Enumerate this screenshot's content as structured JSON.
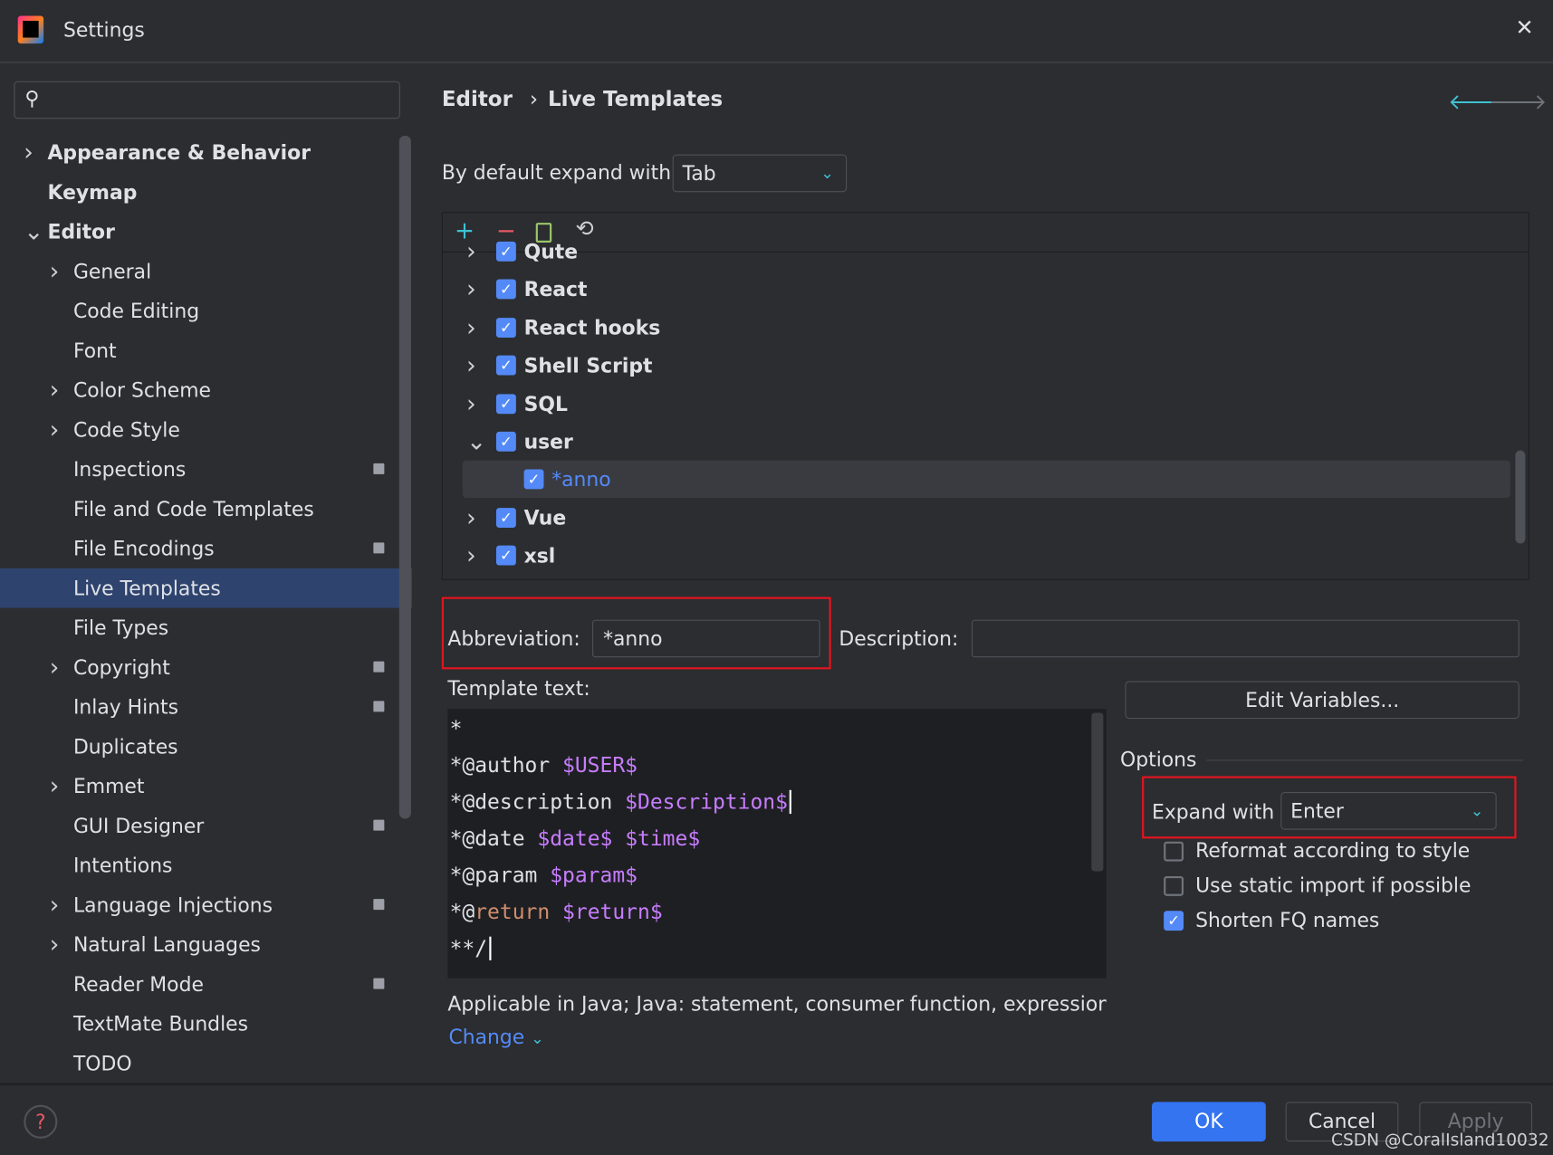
{
  "window": {
    "title": "Settings",
    "close": "✕"
  },
  "search": {
    "placeholder": "",
    "icon": "search-icon"
  },
  "sidebar": {
    "items": [
      {
        "label": "Appearance & Behavior",
        "level": 0,
        "chevron": "right",
        "bold": true
      },
      {
        "label": "Keymap",
        "level": 0,
        "bold": true
      },
      {
        "label": "Editor",
        "level": 0,
        "chevron": "down",
        "bold": true
      },
      {
        "label": "General",
        "level": 1,
        "chevron": "right"
      },
      {
        "label": "Code Editing",
        "level": 1
      },
      {
        "label": "Font",
        "level": 1
      },
      {
        "label": "Color Scheme",
        "level": 1,
        "chevron": "right"
      },
      {
        "label": "Code Style",
        "level": 1,
        "chevron": "right"
      },
      {
        "label": "Inspections",
        "level": 1,
        "pin": true
      },
      {
        "label": "File and Code Templates",
        "level": 1
      },
      {
        "label": "File Encodings",
        "level": 1,
        "pin": true
      },
      {
        "label": "Live Templates",
        "level": 1,
        "selected": true
      },
      {
        "label": "File Types",
        "level": 1
      },
      {
        "label": "Copyright",
        "level": 1,
        "chevron": "right",
        "pin": true
      },
      {
        "label": "Inlay Hints",
        "level": 1,
        "pin": true
      },
      {
        "label": "Duplicates",
        "level": 1
      },
      {
        "label": "Emmet",
        "level": 1,
        "chevron": "right"
      },
      {
        "label": "GUI Designer",
        "level": 1,
        "pin": true
      },
      {
        "label": "Intentions",
        "level": 1
      },
      {
        "label": "Language Injections",
        "level": 1,
        "chevron": "right",
        "pin": true
      },
      {
        "label": "Natural Languages",
        "level": 1,
        "chevron": "right"
      },
      {
        "label": "Reader Mode",
        "level": 1,
        "pin": true
      },
      {
        "label": "TextMate Bundles",
        "level": 1
      },
      {
        "label": "TODO",
        "level": 1
      }
    ]
  },
  "breadcrumb": {
    "parent": "Editor",
    "sep": "›",
    "current": "Live Templates"
  },
  "default_expand": {
    "label": "By default expand with",
    "value": "Tab"
  },
  "tree": {
    "rows": [
      {
        "label": "Qute",
        "checked": true,
        "expanded": false
      },
      {
        "label": "React",
        "checked": true,
        "expanded": false
      },
      {
        "label": "React hooks",
        "checked": true,
        "expanded": false
      },
      {
        "label": "Shell Script",
        "checked": true,
        "expanded": false
      },
      {
        "label": "SQL",
        "checked": true,
        "expanded": false
      },
      {
        "label": "user",
        "checked": true,
        "expanded": true
      },
      {
        "label": "*anno",
        "checked": true,
        "child": true,
        "selected": true
      },
      {
        "label": "Vue",
        "checked": true,
        "expanded": false
      },
      {
        "label": "xsl",
        "checked": true,
        "expanded": false
      }
    ]
  },
  "abbreviation": {
    "label": "Abbreviation:",
    "value": "*anno"
  },
  "description": {
    "label": "Description:",
    "value": ""
  },
  "template_text": {
    "label": "Template text:",
    "lines": [
      [
        {
          "t": "*"
        }
      ],
      [
        {
          "t": "*@author "
        },
        {
          "t": "$USER$",
          "c": "v"
        }
      ],
      [
        {
          "t": "*@description "
        },
        {
          "t": "$Description$",
          "c": "v"
        }
      ],
      [
        {
          "t": "*@date "
        },
        {
          "t": "$date$",
          "c": "v"
        },
        {
          "t": " "
        },
        {
          "t": "$time$",
          "c": "v"
        }
      ],
      [
        {
          "t": "*@param "
        },
        {
          "t": "$param$",
          "c": "v"
        }
      ],
      [
        {
          "t": "*@"
        },
        {
          "t": "return",
          "c": "o"
        },
        {
          "t": " "
        },
        {
          "t": "$return$",
          "c": "v"
        }
      ],
      [
        {
          "t": "**/"
        }
      ]
    ]
  },
  "edit_variables": "Edit Variables...",
  "options": {
    "title": "Options",
    "expand_label": "Expand with",
    "expand_value": "Enter",
    "checks": [
      {
        "label": "Reformat according to style",
        "checked": false
      },
      {
        "label": "Use static import if possible",
        "checked": false
      },
      {
        "label": "Shorten FQ names",
        "checked": true
      }
    ]
  },
  "applicable": "Applicable in Java; Java: statement, consumer function, expression, '",
  "change": "Change",
  "footer": {
    "ok": "OK",
    "cancel": "Cancel",
    "apply": "Apply",
    "watermark": "CSDN @CoralIsland10032"
  },
  "colors": {
    "accent": "#3574f0",
    "selection": "#2e436e",
    "highlight_box": "#e3141f",
    "variable": "#c77dff",
    "keyword": "#cf8e6d"
  }
}
